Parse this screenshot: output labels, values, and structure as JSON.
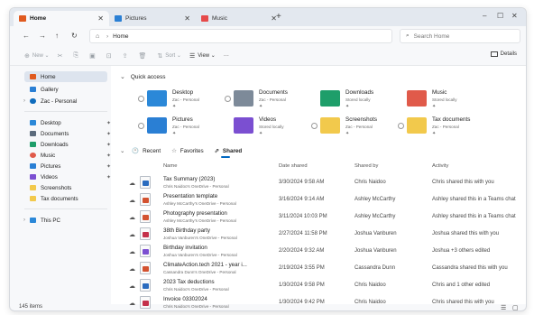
{
  "tabs": [
    {
      "label": "Home",
      "active": true,
      "color": "#e05a1f"
    },
    {
      "label": "Pictures",
      "active": false,
      "color": "#2a7fd4"
    },
    {
      "label": "Music",
      "active": false,
      "color": "#e64a4a"
    }
  ],
  "new_tab": "+",
  "window_controls": {
    "minimize": "–",
    "maximize": "☐",
    "close": "✕"
  },
  "nav": {
    "back": "←",
    "forward": "→",
    "up": "↑",
    "refresh": "↻"
  },
  "address": {
    "home_icon": "⌂",
    "separator": "›",
    "path": "Home"
  },
  "search": {
    "placeholder": "Search Home",
    "icon": "⌕"
  },
  "commands": [
    {
      "label": "New",
      "icon": "⊕",
      "enabled": false
    },
    {
      "label": "",
      "icon": "✂",
      "enabled": false
    },
    {
      "label": "",
      "icon": "⎘",
      "enabled": false
    },
    {
      "label": "",
      "icon": "▣",
      "enabled": false
    },
    {
      "label": "",
      "icon": "⊡",
      "enabled": false
    },
    {
      "label": "",
      "icon": "⇪",
      "enabled": false
    },
    {
      "label": "",
      "icon": "🗑",
      "enabled": false
    },
    {
      "label": "Sort",
      "icon": "⇅",
      "enabled": false
    },
    {
      "label": "View",
      "icon": "☰",
      "enabled": true
    },
    {
      "label": "···",
      "icon": "",
      "enabled": true
    }
  ],
  "details_label": "Details",
  "sidebar": {
    "top": [
      {
        "label": "Home",
        "color": "#e05a1f",
        "active": true
      },
      {
        "label": "Gallery",
        "color": "#2a7fd4",
        "active": false
      },
      {
        "label": "Zac - Personal",
        "color": "#0f6cbd",
        "active": false,
        "chevron": "›"
      }
    ],
    "pinned": [
      {
        "label": "Desktop",
        "color": "#2b88d8",
        "pin": "📌"
      },
      {
        "label": "Documents",
        "color": "#5b6b7c",
        "pin": "📌"
      },
      {
        "label": "Downloads",
        "color": "#1e9e6a",
        "pin": "📌"
      },
      {
        "label": "Music",
        "color": "#e05a4a",
        "pin": "📌"
      },
      {
        "label": "Pictures",
        "color": "#2a7fd4",
        "pin": "📌"
      },
      {
        "label": "Videos",
        "color": "#7b4fd1",
        "pin": "📌"
      },
      {
        "label": "Screenshots",
        "color": "#f2c94c",
        "pin": ""
      },
      {
        "label": "Tax documents",
        "color": "#f2c94c",
        "pin": ""
      }
    ],
    "this_pc": {
      "label": "This PC",
      "color": "#2b88d8",
      "chevron": "›"
    }
  },
  "quick_access": {
    "heading": "Quick access",
    "items": [
      {
        "name": "Desktop",
        "sub": "Zac - Personal",
        "color": "#2b88d8",
        "checkbox": true
      },
      {
        "name": "Documents",
        "sub": "Zac - Personal",
        "color": "#7d8a99",
        "checkbox": true
      },
      {
        "name": "Downloads",
        "sub": "Stored locally",
        "color": "#1e9e6a",
        "checkbox": false
      },
      {
        "name": "Music",
        "sub": "Stored locally",
        "color": "#e05a4a",
        "checkbox": false
      },
      {
        "name": "Pictures",
        "sub": "Zac - Personal",
        "color": "#2a7fd4",
        "checkbox": true
      },
      {
        "name": "Videos",
        "sub": "Stored locally",
        "color": "#7b4fd1",
        "checkbox": false
      },
      {
        "name": "Screenshots",
        "sub": "Zac - Personal",
        "color": "#f2c94c",
        "checkbox": true
      },
      {
        "name": "Tax documents",
        "sub": "Zac - Personal",
        "color": "#f2c94c",
        "checkbox": true
      }
    ],
    "pin_glyph": "📌"
  },
  "file_tabs": [
    {
      "label": "Recent",
      "icon": "🕐",
      "selected": false
    },
    {
      "label": "Favorites",
      "icon": "☆",
      "selected": false
    },
    {
      "label": "Shared",
      "icon": "⇗",
      "selected": true
    }
  ],
  "columns": {
    "name": "Name",
    "date": "Date shared",
    "by": "Shared by",
    "activity": "Activity"
  },
  "files": [
    {
      "name": "Tax Summary (2023)",
      "loc": "Chris Naidoo's OneDrive - Personal",
      "date": "3/30/2024 9:58 AM",
      "by": "Chris Naidoo",
      "activity": "Chris shared this with you",
      "color": "#2b6cbf"
    },
    {
      "name": "Presentation template",
      "loc": "Ashley McCarthy's OneDrive - Personal",
      "date": "3/16/2024 9:14 AM",
      "by": "Ashley McCarthy",
      "activity": "Ashley shared this in a Teams chat",
      "color": "#d35230"
    },
    {
      "name": "Photography presentation",
      "loc": "Ashley McCarthy's OneDrive - Personal",
      "date": "3/11/2024 10:03 PM",
      "by": "Ashley McCarthy",
      "activity": "Ashley shared this in a Teams chat",
      "color": "#d35230"
    },
    {
      "name": "38th Birthday party",
      "loc": "Joshua Vanburen's OneDrive - Personal",
      "date": "2/27/2024 11:58 PM",
      "by": "Joshua Vanburen",
      "activity": "Joshua shared this with you",
      "color": "#c4314b"
    },
    {
      "name": "Birthday invitation",
      "loc": "Joshua Vanburen's OneDrive - Personal",
      "date": "2/20/2024 9:32 AM",
      "by": "Joshua Vanburen",
      "activity": "Joshua +3 others edited",
      "color": "#7b4fd1"
    },
    {
      "name": "ClimateAction.tech 2021 - year i...",
      "loc": "Cassandra Dunn's OneDrive - Personal",
      "date": "2/19/2024 3:55 PM",
      "by": "Cassandra Dunn",
      "activity": "Cassandra shared this with you",
      "color": "#d35230"
    },
    {
      "name": "2023 Tax deductions",
      "loc": "Chris Naidoo's OneDrive - Personal",
      "date": "1/30/2024 9:58 PM",
      "by": "Chris Naidoo",
      "activity": "Chris and 1 other edited",
      "color": "#2b6cbf"
    },
    {
      "name": "Invoice 03302024",
      "loc": "Chris Naidoo's OneDrive - Personal",
      "date": "1/30/2024 9:42 PM",
      "by": "Chris Naidoo",
      "activity": "Chris shared this with you",
      "color": "#c4314b"
    }
  ],
  "cloud_glyph": "☁",
  "status": {
    "count": "145 items",
    "view_list": "☰",
    "view_grid": "▢"
  }
}
